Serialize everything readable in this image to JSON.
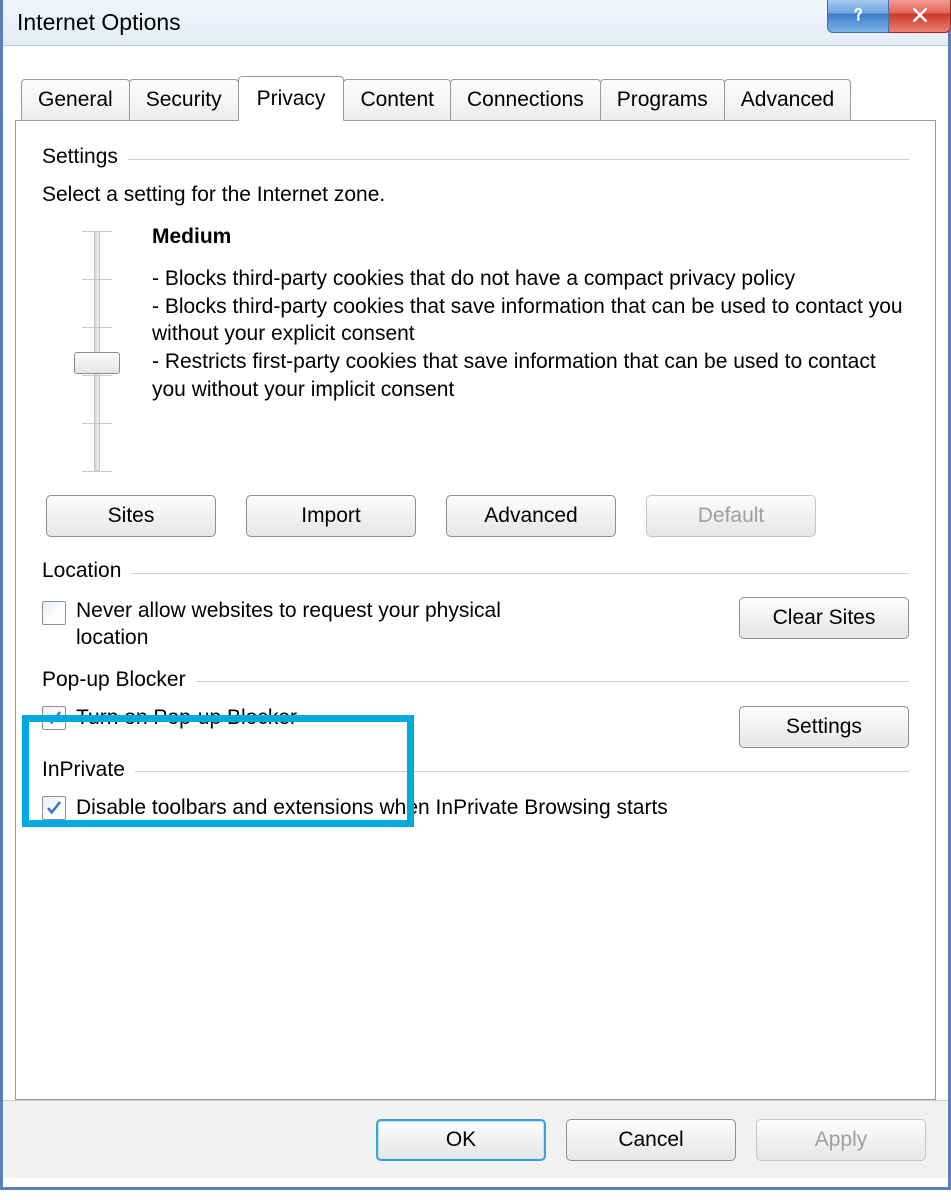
{
  "title": "Internet Options",
  "tabs": [
    "General",
    "Security",
    "Privacy",
    "Content",
    "Connections",
    "Programs",
    "Advanced"
  ],
  "active_tab_index": 2,
  "sections": {
    "settings": {
      "label": "Settings",
      "intro": "Select a setting for the Internet zone.",
      "level_name": "Medium",
      "level_bullets": [
        "- Blocks third-party cookies that do not have a compact privacy policy",
        "- Blocks third-party cookies that save information that can be used to contact you without your explicit consent",
        "- Restricts first-party cookies that save information that can be used to contact you without your implicit consent"
      ],
      "buttons": {
        "sites": "Sites",
        "import": "Import",
        "advanced": "Advanced",
        "default": "Default"
      }
    },
    "location": {
      "label": "Location",
      "checkbox": "Never allow websites to request your physical location",
      "checked": false,
      "button": "Clear Sites"
    },
    "popup": {
      "label": "Pop-up Blocker",
      "checkbox": "Turn on Pop-up Blocker",
      "checked": true,
      "button": "Settings"
    },
    "inprivate": {
      "label": "InPrivate",
      "checkbox": "Disable toolbars and extensions when InPrivate Browsing starts",
      "checked": true
    }
  },
  "footer": {
    "ok": "OK",
    "cancel": "Cancel",
    "apply": "Apply"
  }
}
